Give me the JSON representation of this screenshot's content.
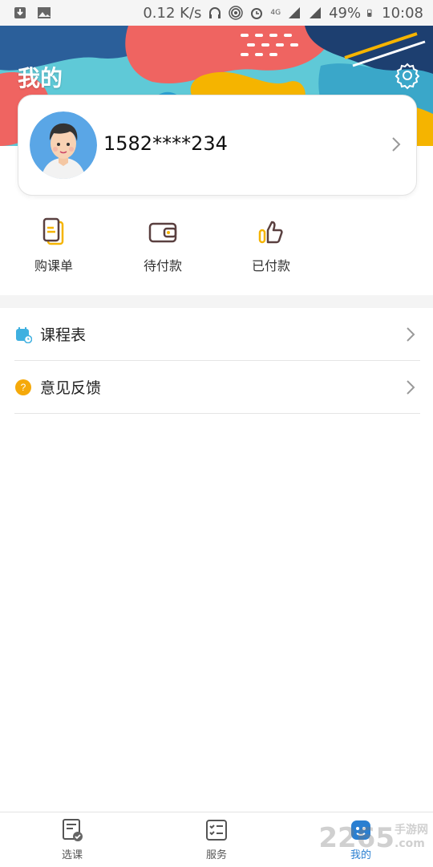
{
  "status_bar": {
    "speed": "0.12 K/s",
    "network": "4G",
    "battery": "49%",
    "time": "10:08"
  },
  "header": {
    "title": "我的"
  },
  "profile": {
    "phone": "1582****234"
  },
  "quick_actions": [
    {
      "label": "购课单",
      "icon": "course-list-icon"
    },
    {
      "label": "待付款",
      "icon": "wallet-icon"
    },
    {
      "label": "已付款",
      "icon": "thumbs-up-icon"
    }
  ],
  "menu": [
    {
      "label": "课程表",
      "icon": "calendar-icon"
    },
    {
      "label": "意见反馈",
      "icon": "question-icon"
    }
  ],
  "bottom_nav": [
    {
      "label": "选课",
      "icon": "select-course-icon"
    },
    {
      "label": "服务",
      "icon": "service-checklist-icon"
    },
    {
      "label": "我的",
      "icon": "me-icon",
      "active": true
    }
  ],
  "watermark": {
    "text": "2265",
    "suffix": "手游网",
    "domain": ".com"
  },
  "colors": {
    "accent_blue": "#2a7fd1",
    "accent_yellow": "#f5b400",
    "coral": "#ef6461"
  }
}
